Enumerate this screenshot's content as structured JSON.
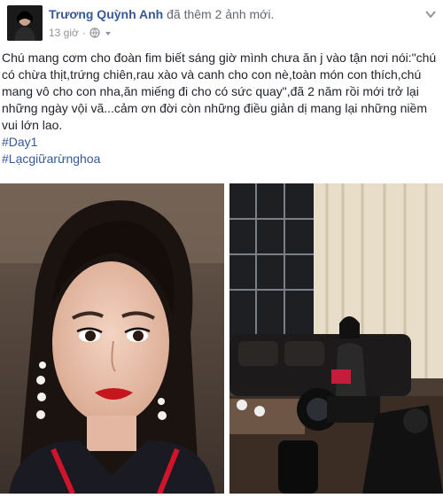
{
  "post": {
    "author": "Trương Quỳnh Anh",
    "action": " đã thêm 2 ảnh mới.",
    "time": "13 giờ",
    "text": "Chú mang cơm cho đoàn fim biết sáng giờ mình chưa ăn j vào tận nơi nói:\"chú có chừa thịt,trứng chiên,rau xào và canh cho con nè,toàn món con thích,chú mang vô cho con nha,ăn miếng đi cho có sức quay\",đã 2 năm rồi mới trở lại những ngày vội vã...cảm ơn đời còn những điều giản dị mang lại những niềm vui lớn lao.",
    "hashtags": [
      "#Day1",
      "#Lạcgiữarừnghoa"
    ]
  },
  "icons": {
    "audience": "globe-icon",
    "menu": "chevron-down-icon"
  },
  "colors": {
    "link": "#365899",
    "meta": "#90949c",
    "text": "#1d2129"
  }
}
